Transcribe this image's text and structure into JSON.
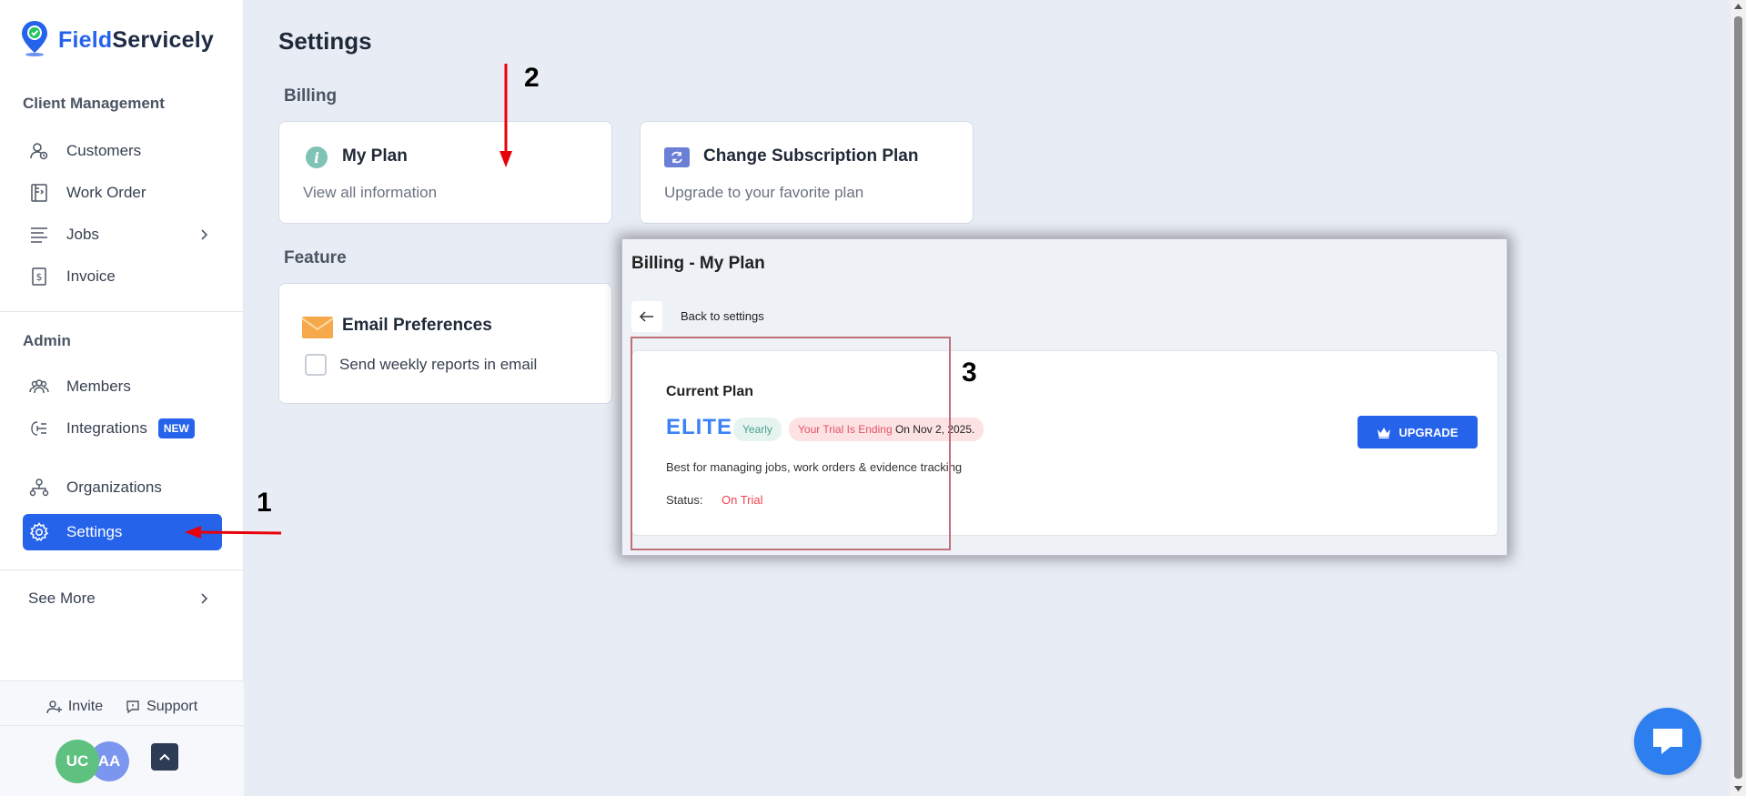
{
  "app": {
    "brand_part1": "Field",
    "brand_part2": "Servicely"
  },
  "sidebar": {
    "client_section": "Client Management",
    "client_items": [
      {
        "label": "Customers",
        "icon": "customers-icon"
      },
      {
        "label": "Work Order",
        "icon": "work-order-icon"
      },
      {
        "label": "Jobs",
        "icon": "jobs-icon"
      },
      {
        "label": "Invoice",
        "icon": "invoice-icon"
      }
    ],
    "admin_section": "Admin",
    "admin_items": [
      {
        "label": "Members",
        "icon": "members-icon"
      },
      {
        "label": "Integrations",
        "icon": "integrations-icon",
        "badge": "NEW"
      },
      {
        "label": "Organizations",
        "icon": "organizations-icon"
      },
      {
        "label": "Settings",
        "icon": "settings-icon",
        "active": true
      }
    ],
    "see_more": "See More",
    "footer": {
      "invite": "Invite",
      "support": "Support",
      "avatar1": "UC",
      "avatar2": "AA"
    }
  },
  "main": {
    "title": "Settings",
    "billing_group": "Billing",
    "my_plan": {
      "title": "My Plan",
      "subtitle": "View all information"
    },
    "change_plan": {
      "title": "Change Subscription Plan",
      "subtitle": "Upgrade to your favorite plan"
    },
    "feature_group": "Feature",
    "email_pref": {
      "title": "Email Preferences",
      "checkbox_label": "Send weekly reports in email",
      "checked": false
    }
  },
  "overlay": {
    "title": "Billing - My Plan",
    "back_label": "Back to settings",
    "current_plan": "Current Plan",
    "plan_name": "ELITE",
    "cycle": "Yearly",
    "trial_red": "Your Trial Is Ending",
    "trial_date": "On Nov 2, 2025.",
    "description": "Best for managing jobs, work orders & evidence tracking",
    "status_label": "Status:",
    "status_value": "On Trial",
    "upgrade": "UPGRADE"
  },
  "annotations": {
    "n1": "1",
    "n2": "2",
    "n3": "3"
  },
  "colors": {
    "accent": "#2563eb",
    "arrow": "#e8000b",
    "trial_red": "#e35364"
  }
}
